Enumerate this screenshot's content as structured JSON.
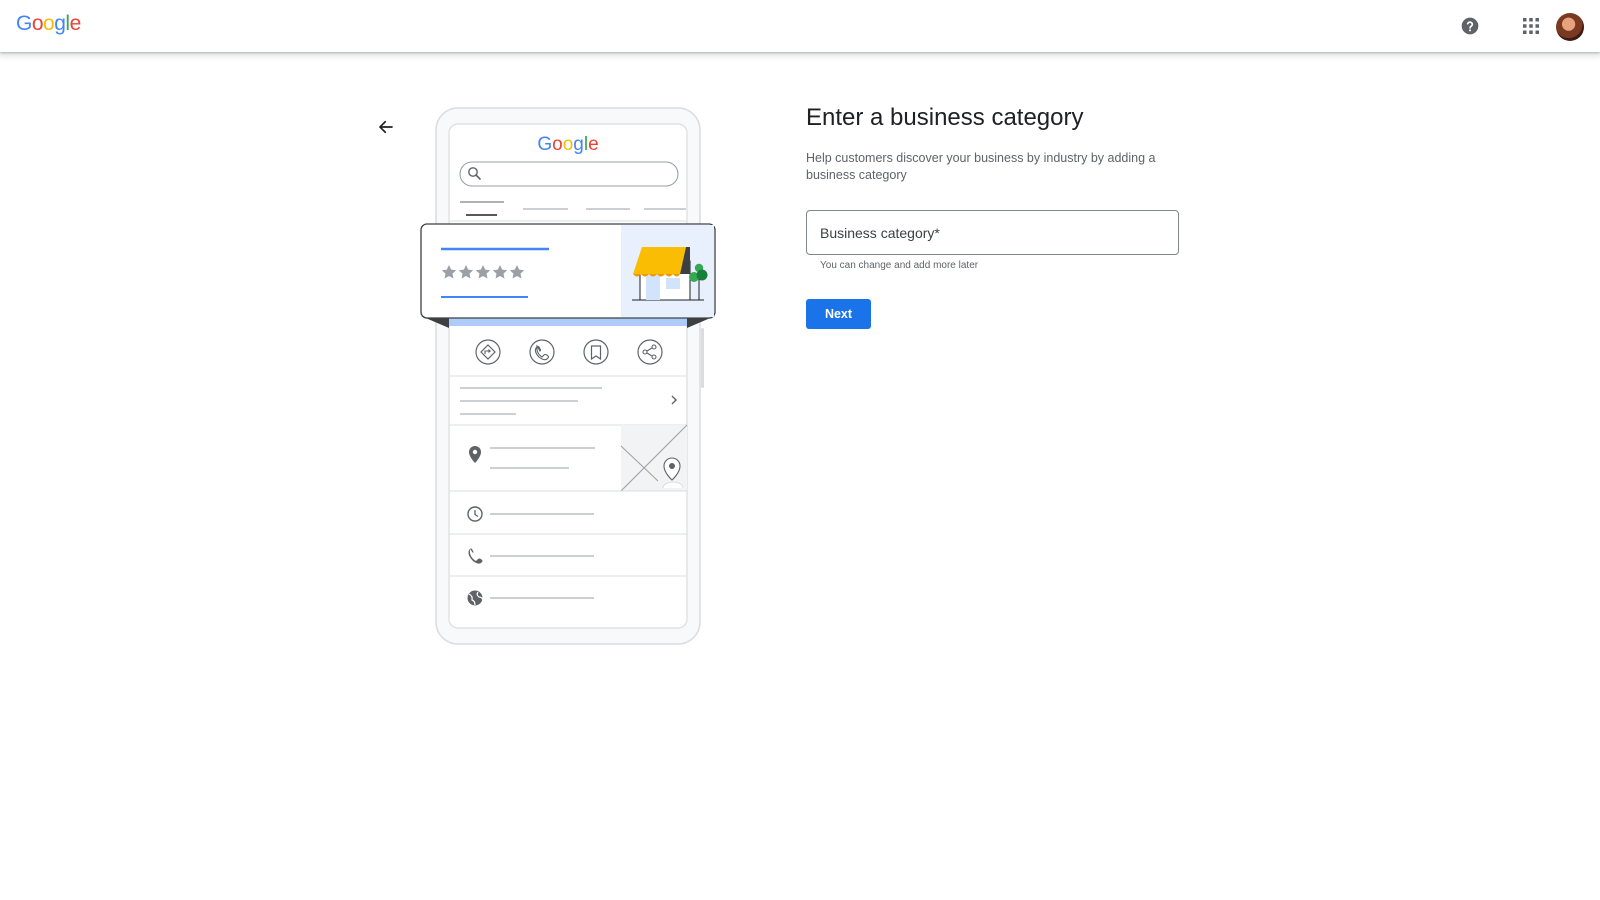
{
  "header": {
    "logo_letters": [
      {
        "char": "G",
        "color": "#4285F4"
      },
      {
        "char": "o",
        "color": "#EA4335"
      },
      {
        "char": "o",
        "color": "#FBBC05"
      },
      {
        "char": "g",
        "color": "#4285F4"
      },
      {
        "char": "l",
        "color": "#34A853"
      },
      {
        "char": "e",
        "color": "#EA4335"
      }
    ],
    "help_icon": "help-circle-icon",
    "apps_icon": "apps-grid-icon",
    "avatar": "user-avatar"
  },
  "illustration": {
    "logo_text": "Google",
    "star_count": 5,
    "icons": [
      "search-icon",
      "directions-icon",
      "phone-icon",
      "bookmark-icon",
      "share-icon",
      "chevron-right-icon",
      "location-pin-icon",
      "clock-icon",
      "phone-icon",
      "globe-icon",
      "storefront-icon"
    ],
    "colors": {
      "awning": "#FBBC04",
      "store_bg": "#E8F0FE",
      "tree": "#34A853",
      "accent": "#4285F4"
    }
  },
  "form": {
    "back_icon": "arrow-back-icon",
    "title": "Enter a business category",
    "description": "Help customers discover your business by industry by adding a business category",
    "field_placeholder": "Business category*",
    "field_value": "",
    "hint": "You can change and add more later",
    "next_label": "Next",
    "accent_color": "#1a73e8"
  }
}
